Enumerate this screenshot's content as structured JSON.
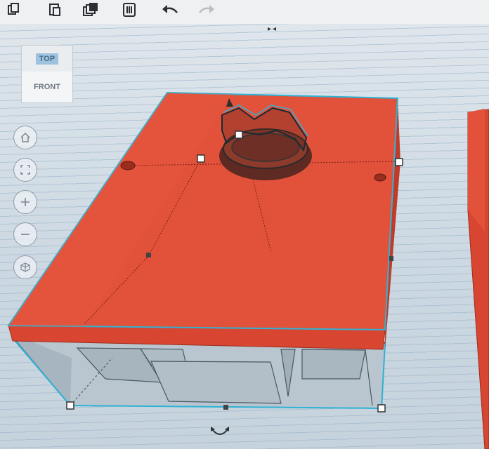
{
  "toolbar": {
    "buttons": [
      {
        "icon": "copy-icon"
      },
      {
        "icon": "paste-icon"
      },
      {
        "icon": "duplicate-icon"
      },
      {
        "icon": "delete-icon"
      },
      {
        "icon": "undo-icon"
      },
      {
        "icon": "redo-icon"
      }
    ]
  },
  "viewcube": {
    "top_label": "TOP",
    "front_label": "FRONT"
  },
  "nav": [
    "home-view-icon",
    "fit-all-icon",
    "zoom-in-icon",
    "zoom-out-icon",
    "perspective-icon"
  ],
  "colors": {
    "box_fill": "#e2513a",
    "box_top": "#df4b32",
    "selection_outline": "#2fb3d6",
    "workplane": "#cbd7e1"
  }
}
